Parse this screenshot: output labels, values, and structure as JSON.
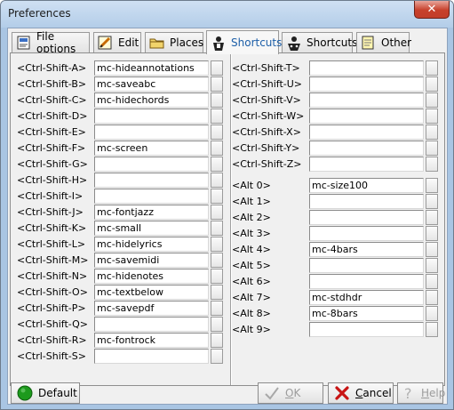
{
  "window": {
    "title": "Preferences",
    "close_glyph": "✕"
  },
  "tabs": [
    {
      "label": "File options",
      "icon": "file-options-icon",
      "active": false
    },
    {
      "label": "Edit",
      "icon": "edit-icon",
      "active": false
    },
    {
      "label": "Places",
      "icon": "folder-icon",
      "active": false
    },
    {
      "label": "Shortcuts",
      "icon": "shortcuts-icon",
      "active": true
    },
    {
      "label": "Shortcuts",
      "icon": "shortcuts-person-icon",
      "active": false
    },
    {
      "label": "Other",
      "icon": "notepad-icon",
      "active": false
    }
  ],
  "left_shortcuts": [
    {
      "key": "<Ctrl-Shift-A>",
      "value": "mc-hideannotations"
    },
    {
      "key": "<Ctrl-Shift-B>",
      "value": "mc-saveabc"
    },
    {
      "key": "<Ctrl-Shift-C>",
      "value": "mc-hidechords"
    },
    {
      "key": "<Ctrl-Shift-D>",
      "value": ""
    },
    {
      "key": "<Ctrl-Shift-E>",
      "value": ""
    },
    {
      "key": "<Ctrl-Shift-F>",
      "value": "mc-screen"
    },
    {
      "key": "<Ctrl-Shift-G>",
      "value": ""
    },
    {
      "key": "<Ctrl-Shift-H>",
      "value": ""
    },
    {
      "key": "<Ctrl-Shift-I>",
      "value": ""
    },
    {
      "key": "<Ctrl-Shift-J>",
      "value": "mc-fontjazz"
    },
    {
      "key": "<Ctrl-Shift-K>",
      "value": "mc-small"
    },
    {
      "key": "<Ctrl-Shift-L>",
      "value": "mc-hidelyrics"
    },
    {
      "key": "<Ctrl-Shift-M>",
      "value": "mc-savemidi"
    },
    {
      "key": "<Ctrl-Shift-N>",
      "value": "mc-hidenotes"
    },
    {
      "key": "<Ctrl-Shift-O>",
      "value": "mc-textbelow"
    },
    {
      "key": "<Ctrl-Shift-P>",
      "value": "mc-savepdf"
    },
    {
      "key": "<Ctrl-Shift-Q>",
      "value": ""
    },
    {
      "key": "<Ctrl-Shift-R>",
      "value": "mc-fontrock"
    },
    {
      "key": "<Ctrl-Shift-S>",
      "value": ""
    }
  ],
  "right_shortcuts": [
    {
      "key": "<Ctrl-Shift-T>",
      "value": ""
    },
    {
      "key": "<Ctrl-Shift-U>",
      "value": ""
    },
    {
      "key": "<Ctrl-Shift-V>",
      "value": ""
    },
    {
      "key": "<Ctrl-Shift-W>",
      "value": ""
    },
    {
      "key": "<Ctrl-Shift-X>",
      "value": ""
    },
    {
      "key": "<Ctrl-Shift-Y>",
      "value": ""
    },
    {
      "key": "<Ctrl-Shift-Z>",
      "value": ""
    }
  ],
  "alt_shortcuts": [
    {
      "key": "<Alt 0>",
      "value": "mc-size100"
    },
    {
      "key": "<Alt 1>",
      "value": ""
    },
    {
      "key": "<Alt 2>",
      "value": ""
    },
    {
      "key": "<Alt 3>",
      "value": ""
    },
    {
      "key": "<Alt 4>",
      "value": "mc-4bars"
    },
    {
      "key": "<Alt 5>",
      "value": ""
    },
    {
      "key": "<Alt 6>",
      "value": ""
    },
    {
      "key": "<Alt 7>",
      "value": "mc-stdhdr"
    },
    {
      "key": "<Alt 8>",
      "value": "mc-8bars"
    },
    {
      "key": "<Alt 9>",
      "value": ""
    }
  ],
  "buttons": {
    "default": {
      "label": "Default",
      "icon": "green-circle-icon"
    },
    "ok": {
      "underline": "O",
      "rest": "K",
      "icon": "check-icon",
      "enabled": false
    },
    "cancel": {
      "underline": "C",
      "rest": "ancel",
      "icon": "red-x-icon",
      "enabled": true
    },
    "help": {
      "underline": "H",
      "rest": "elp",
      "icon": "help-icon",
      "enabled": false
    }
  },
  "colors": {
    "accent_tab_text": "#1d5fa8",
    "default_icon": "#1d9a1d",
    "cancel_icon": "#c81414"
  }
}
